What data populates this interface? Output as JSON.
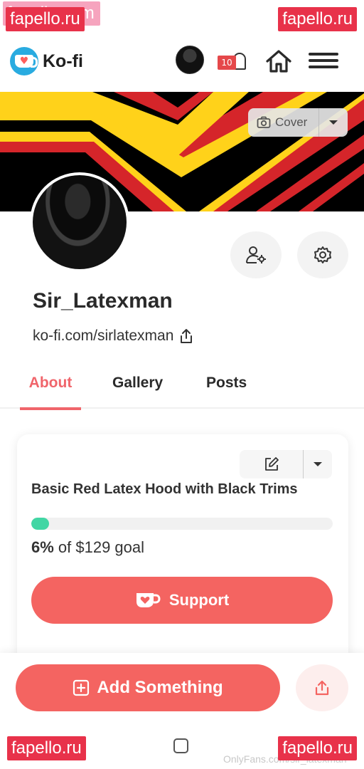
{
  "watermarks": {
    "top_left": "fapello.ru",
    "top_left_ghost": "fapello.com",
    "top_right": "fapello.ru",
    "bottom_left": "fapello.ru",
    "bottom_right": "fapello.ru"
  },
  "header": {
    "brand": "Ko-fi",
    "notification_count": "10"
  },
  "cover": {
    "button_label": "Cover",
    "colors": {
      "black": "#000000",
      "red": "#d5252a",
      "yellow": "#ffd21a"
    }
  },
  "profile": {
    "username": "Sir_Latexman",
    "url": "ko-fi.com/sirlatexman"
  },
  "tabs": [
    {
      "label": "About",
      "active": true
    },
    {
      "label": "Gallery",
      "active": false
    },
    {
      "label": "Posts",
      "active": false
    }
  ],
  "goal": {
    "title": "Basic Red Latex Hood with Black Trims",
    "percent_label": "6%",
    "suffix": "of $129 goal",
    "progress_fraction": 0.06
  },
  "buttons": {
    "support": "Support",
    "add_something": "Add Something"
  },
  "footer": {
    "credit": "OnlyFans.com/sir_latexman"
  },
  "theme": {
    "accent": "#f46461",
    "progress": "#42d6a4",
    "tab_active": "#f0656b"
  }
}
